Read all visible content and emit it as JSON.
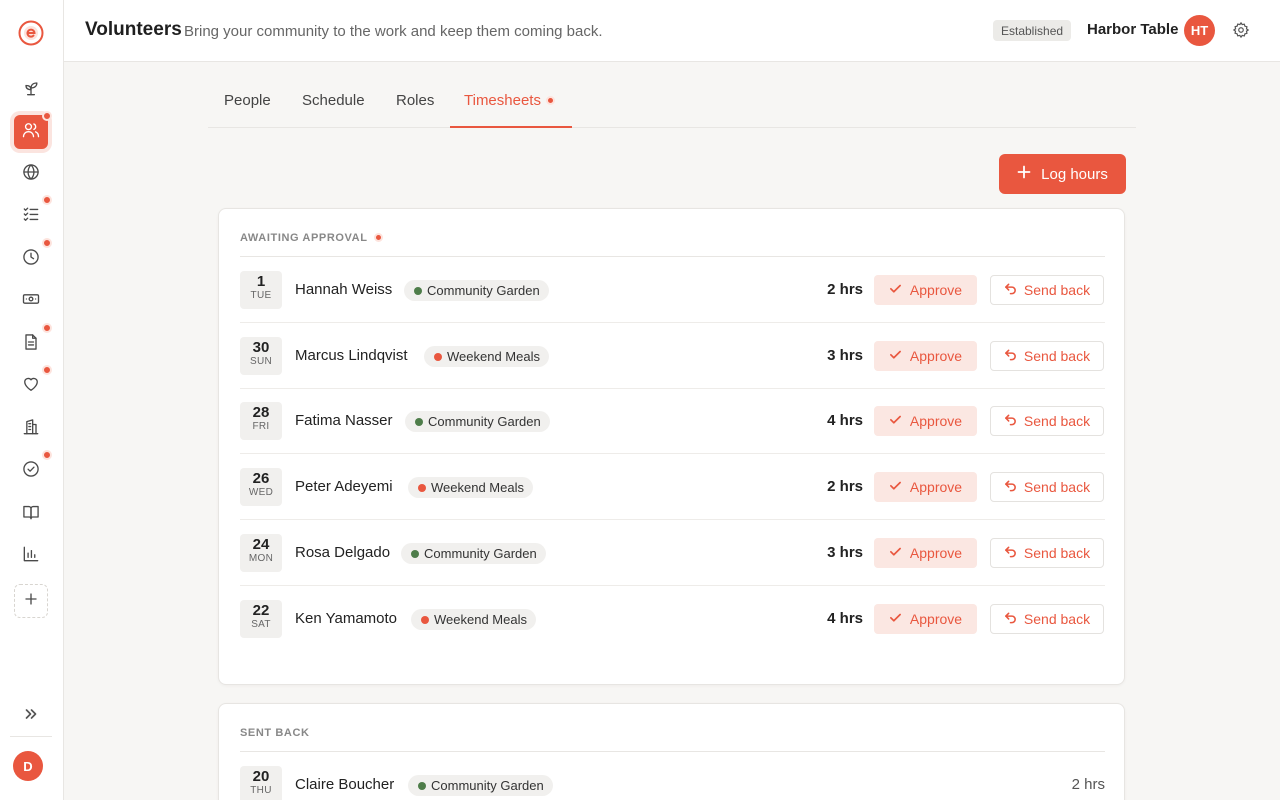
{
  "app": {
    "logo_icon": "e-logo-icon",
    "accent_color": "#e9573f"
  },
  "header": {
    "title": "Volunteers",
    "subtitle": "Bring your community to the work and keep them coming back.",
    "badge": "Established",
    "org_name": "Harbor Table",
    "org_initials": "HT"
  },
  "sidebar": {
    "items": [
      {
        "icon": "sprout-icon"
      },
      {
        "icon": "people-icon",
        "active": true
      },
      {
        "icon": "globe-icon"
      },
      {
        "icon": "checklist-icon"
      },
      {
        "icon": "clock-icon"
      },
      {
        "icon": "cash-icon"
      },
      {
        "icon": "document-icon"
      },
      {
        "icon": "heart-icon"
      },
      {
        "icon": "building-icon"
      },
      {
        "icon": "check-circle-icon"
      },
      {
        "icon": "book-icon"
      },
      {
        "icon": "bar-chart-icon"
      },
      {
        "icon": "plus-icon"
      }
    ],
    "user_initial": "D"
  },
  "tabs": [
    {
      "label": "People"
    },
    {
      "label": "Schedule"
    },
    {
      "label": "Roles"
    },
    {
      "label": "Timesheets",
      "active": true
    }
  ],
  "actions": {
    "log_hours": "Log hours"
  },
  "awaiting": {
    "title": "AWAITING APPROVAL",
    "approve_label": "Approve",
    "send_back_label": "Send back",
    "rows": [
      {
        "day": "1",
        "dow": "TUE",
        "name": "Hannah Weiss",
        "role": "Community Garden",
        "role_color": "#4e7d4a",
        "hours": "2 hrs"
      },
      {
        "day": "30",
        "dow": "SUN",
        "name": "Marcus Lindqvist",
        "role": "Weekend Meals",
        "role_color": "#e9573f",
        "hours": "3 hrs"
      },
      {
        "day": "28",
        "dow": "FRI",
        "name": "Fatima Nasser",
        "role": "Community Garden",
        "role_color": "#4e7d4a",
        "hours": "4 hrs"
      },
      {
        "day": "26",
        "dow": "WED",
        "name": "Peter Adeyemi",
        "role": "Weekend Meals",
        "role_color": "#e9573f",
        "hours": "2 hrs"
      },
      {
        "day": "24",
        "dow": "MON",
        "name": "Rosa Delgado",
        "role": "Community Garden",
        "role_color": "#4e7d4a",
        "hours": "3 hrs"
      },
      {
        "day": "22",
        "dow": "SAT",
        "name": "Ken Yamamoto",
        "role": "Weekend Meals",
        "role_color": "#e9573f",
        "hours": "4 hrs"
      }
    ]
  },
  "sent_back": {
    "title": "SENT BACK",
    "rows": [
      {
        "day": "20",
        "dow": "THU",
        "name": "Claire Boucher",
        "role": "Community Garden",
        "role_color": "#4e7d4a",
        "hours": "2 hrs"
      }
    ]
  }
}
